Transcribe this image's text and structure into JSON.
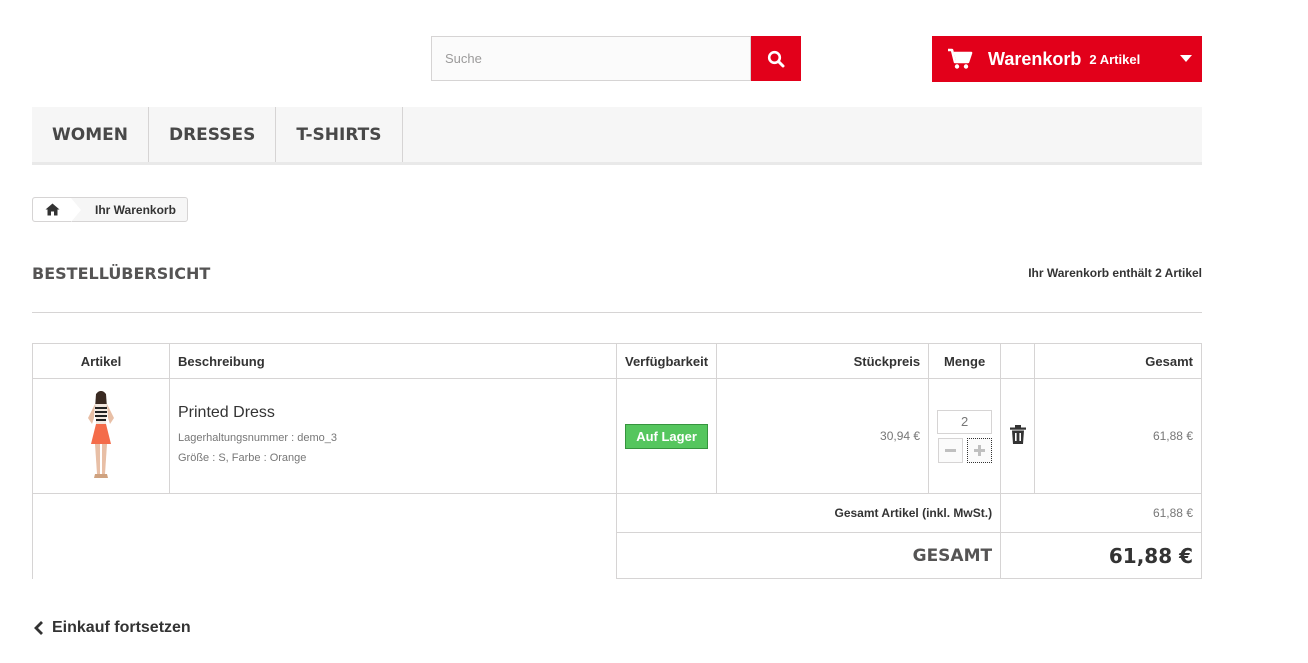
{
  "search": {
    "placeholder": "Suche"
  },
  "cart_block": {
    "title": "Warenkorb",
    "quantity": "2 Artikel"
  },
  "menu": {
    "items": [
      "WOMEN",
      "DRESSES",
      "T-SHIRTS"
    ]
  },
  "breadcrumb": {
    "current": "Ihr Warenkorb"
  },
  "page": {
    "heading": "BESTELLÜBERSICHT",
    "summary": "Ihr Warenkorb enthält 2 Artikel"
  },
  "table": {
    "headers": {
      "article": "Artikel",
      "description": "Beschreibung",
      "availability": "Verfügbarkeit",
      "unit_price": "Stückpreis",
      "quantity": "Menge",
      "total": "Gesamt"
    },
    "product": {
      "name": "Printed Dress",
      "reference": "Lagerhaltungsnummer : demo_3",
      "attributes": "Größe : S, Farbe : Orange",
      "availability": "Auf Lager",
      "unit_price": "30,94 €",
      "quantity": "2",
      "total": "61,88 €"
    },
    "totals": {
      "products_label": "Gesamt Artikel (inkl. MwSt.)",
      "products_value": "61,88 €",
      "grand_label": "GESAMT",
      "grand_value": "61,88 €"
    }
  },
  "continue_link": "Einkauf fortsetzen",
  "colors": {
    "accent": "#e2001a",
    "in_stock": "#55c65e"
  },
  "icons": [
    "search-icon",
    "cart-icon",
    "caret-down-icon",
    "home-icon",
    "trash-icon",
    "chevron-left-icon",
    "minus-icon",
    "plus-icon"
  ]
}
